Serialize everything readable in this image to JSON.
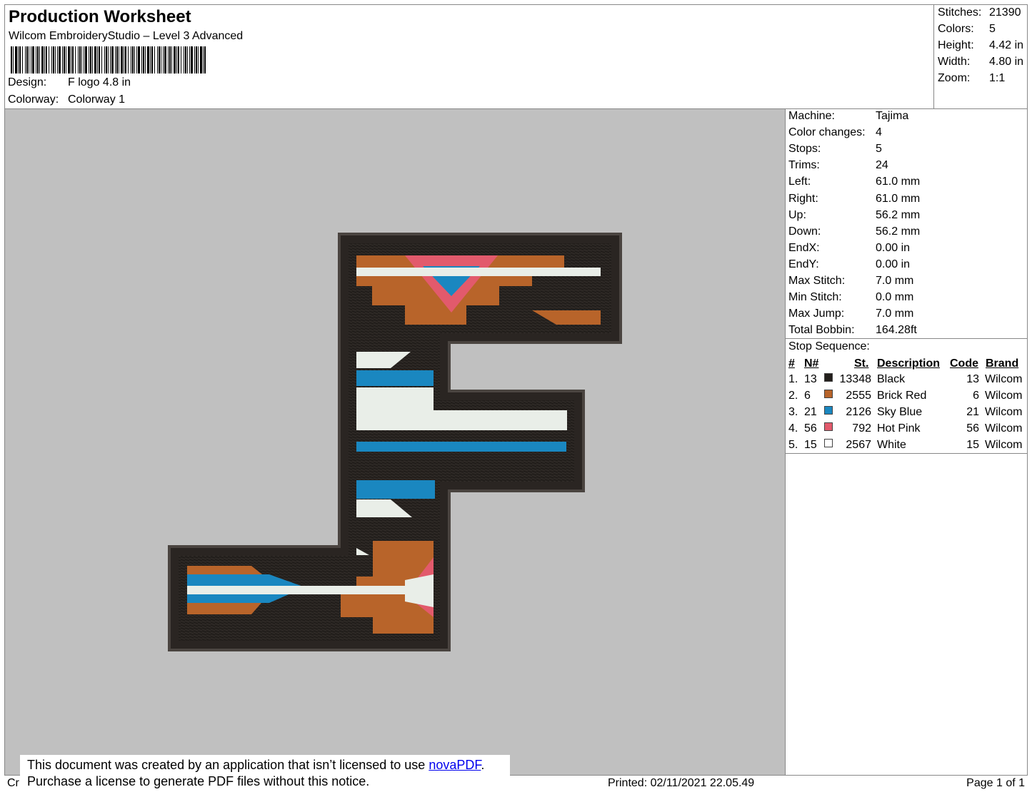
{
  "header": {
    "title": "Production Worksheet",
    "subtitle": "Wilcom EmbroideryStudio – Level 3 Advanced",
    "design_label": "Design:",
    "design_value": "F logo 4.8 in",
    "colorway_label": "Colorway:",
    "colorway_value": "Colorway 1"
  },
  "summary": {
    "stitches_label": "Stitches:",
    "stitches_value": "21390",
    "colors_label": "Colors:",
    "colors_value": "5",
    "height_label": "Height:",
    "height_value": "4.42 in",
    "width_label": "Width:",
    "width_value": "4.80 in",
    "zoom_label": "Zoom:",
    "zoom_value": "1:1"
  },
  "machine_info": [
    {
      "label": "Machine:",
      "value": "Tajima"
    },
    {
      "label": "Color changes:",
      "value": "4"
    },
    {
      "label": "Stops:",
      "value": "5"
    },
    {
      "label": "Trims:",
      "value": "24"
    },
    {
      "label": "Left:",
      "value": "61.0 mm"
    },
    {
      "label": "Right:",
      "value": "61.0 mm"
    },
    {
      "label": "Up:",
      "value": "56.2 mm"
    },
    {
      "label": "Down:",
      "value": "56.2 mm"
    },
    {
      "label": "EndX:",
      "value": "0.00 in"
    },
    {
      "label": "EndY:",
      "value": "0.00 in"
    },
    {
      "label": "Max Stitch:",
      "value": "7.0 mm"
    },
    {
      "label": "Min Stitch:",
      "value": "0.0 mm"
    },
    {
      "label": "Max Jump:",
      "value": "7.0 mm"
    },
    {
      "label": "Total Bobbin:",
      "value": "164.28ft"
    }
  ],
  "stop_sequence": {
    "label": "Stop Sequence:",
    "headers": {
      "num": "#",
      "n": "N#",
      "st": "St.",
      "desc": "Description",
      "code": "Code",
      "brand": "Brand"
    },
    "rows": [
      {
        "num": "1.",
        "n": "13",
        "color": "#231f1c",
        "st": "13348",
        "desc": "Black",
        "code": "13",
        "brand": "Wilcom"
      },
      {
        "num": "2.",
        "n": "6",
        "color": "#b8642a",
        "st": "2555",
        "desc": "Brick Red",
        "code": "6",
        "brand": "Wilcom"
      },
      {
        "num": "3.",
        "n": "21",
        "color": "#1a87c0",
        "st": "2126",
        "desc": "Sky Blue",
        "code": "21",
        "brand": "Wilcom"
      },
      {
        "num": "4.",
        "n": "56",
        "color": "#e25a6c",
        "st": "792",
        "desc": "Hot Pink",
        "code": "56",
        "brand": "Wilcom"
      },
      {
        "num": "5.",
        "n": "15",
        "color": "#ffffff",
        "st": "2567",
        "desc": "White",
        "code": "15",
        "brand": "Wilcom"
      }
    ]
  },
  "footer": {
    "cr": "Cr",
    "printed": "Printed: 02/11/2021 22.05.49",
    "page": "Page 1 of 1"
  },
  "notice": {
    "line1_pre": "This document was created by an application that isn’t licensed to use ",
    "link": "novaPDF",
    "line1_post": ".",
    "line2": "Purchase a license to generate PDF files without this notice."
  },
  "colors": {
    "canvas_bg": "#c0c0c0",
    "black": "#231f1c",
    "brick": "#b8642a",
    "sky": "#1a87c0",
    "pink": "#e25a6c",
    "white": "#e9eee8"
  }
}
